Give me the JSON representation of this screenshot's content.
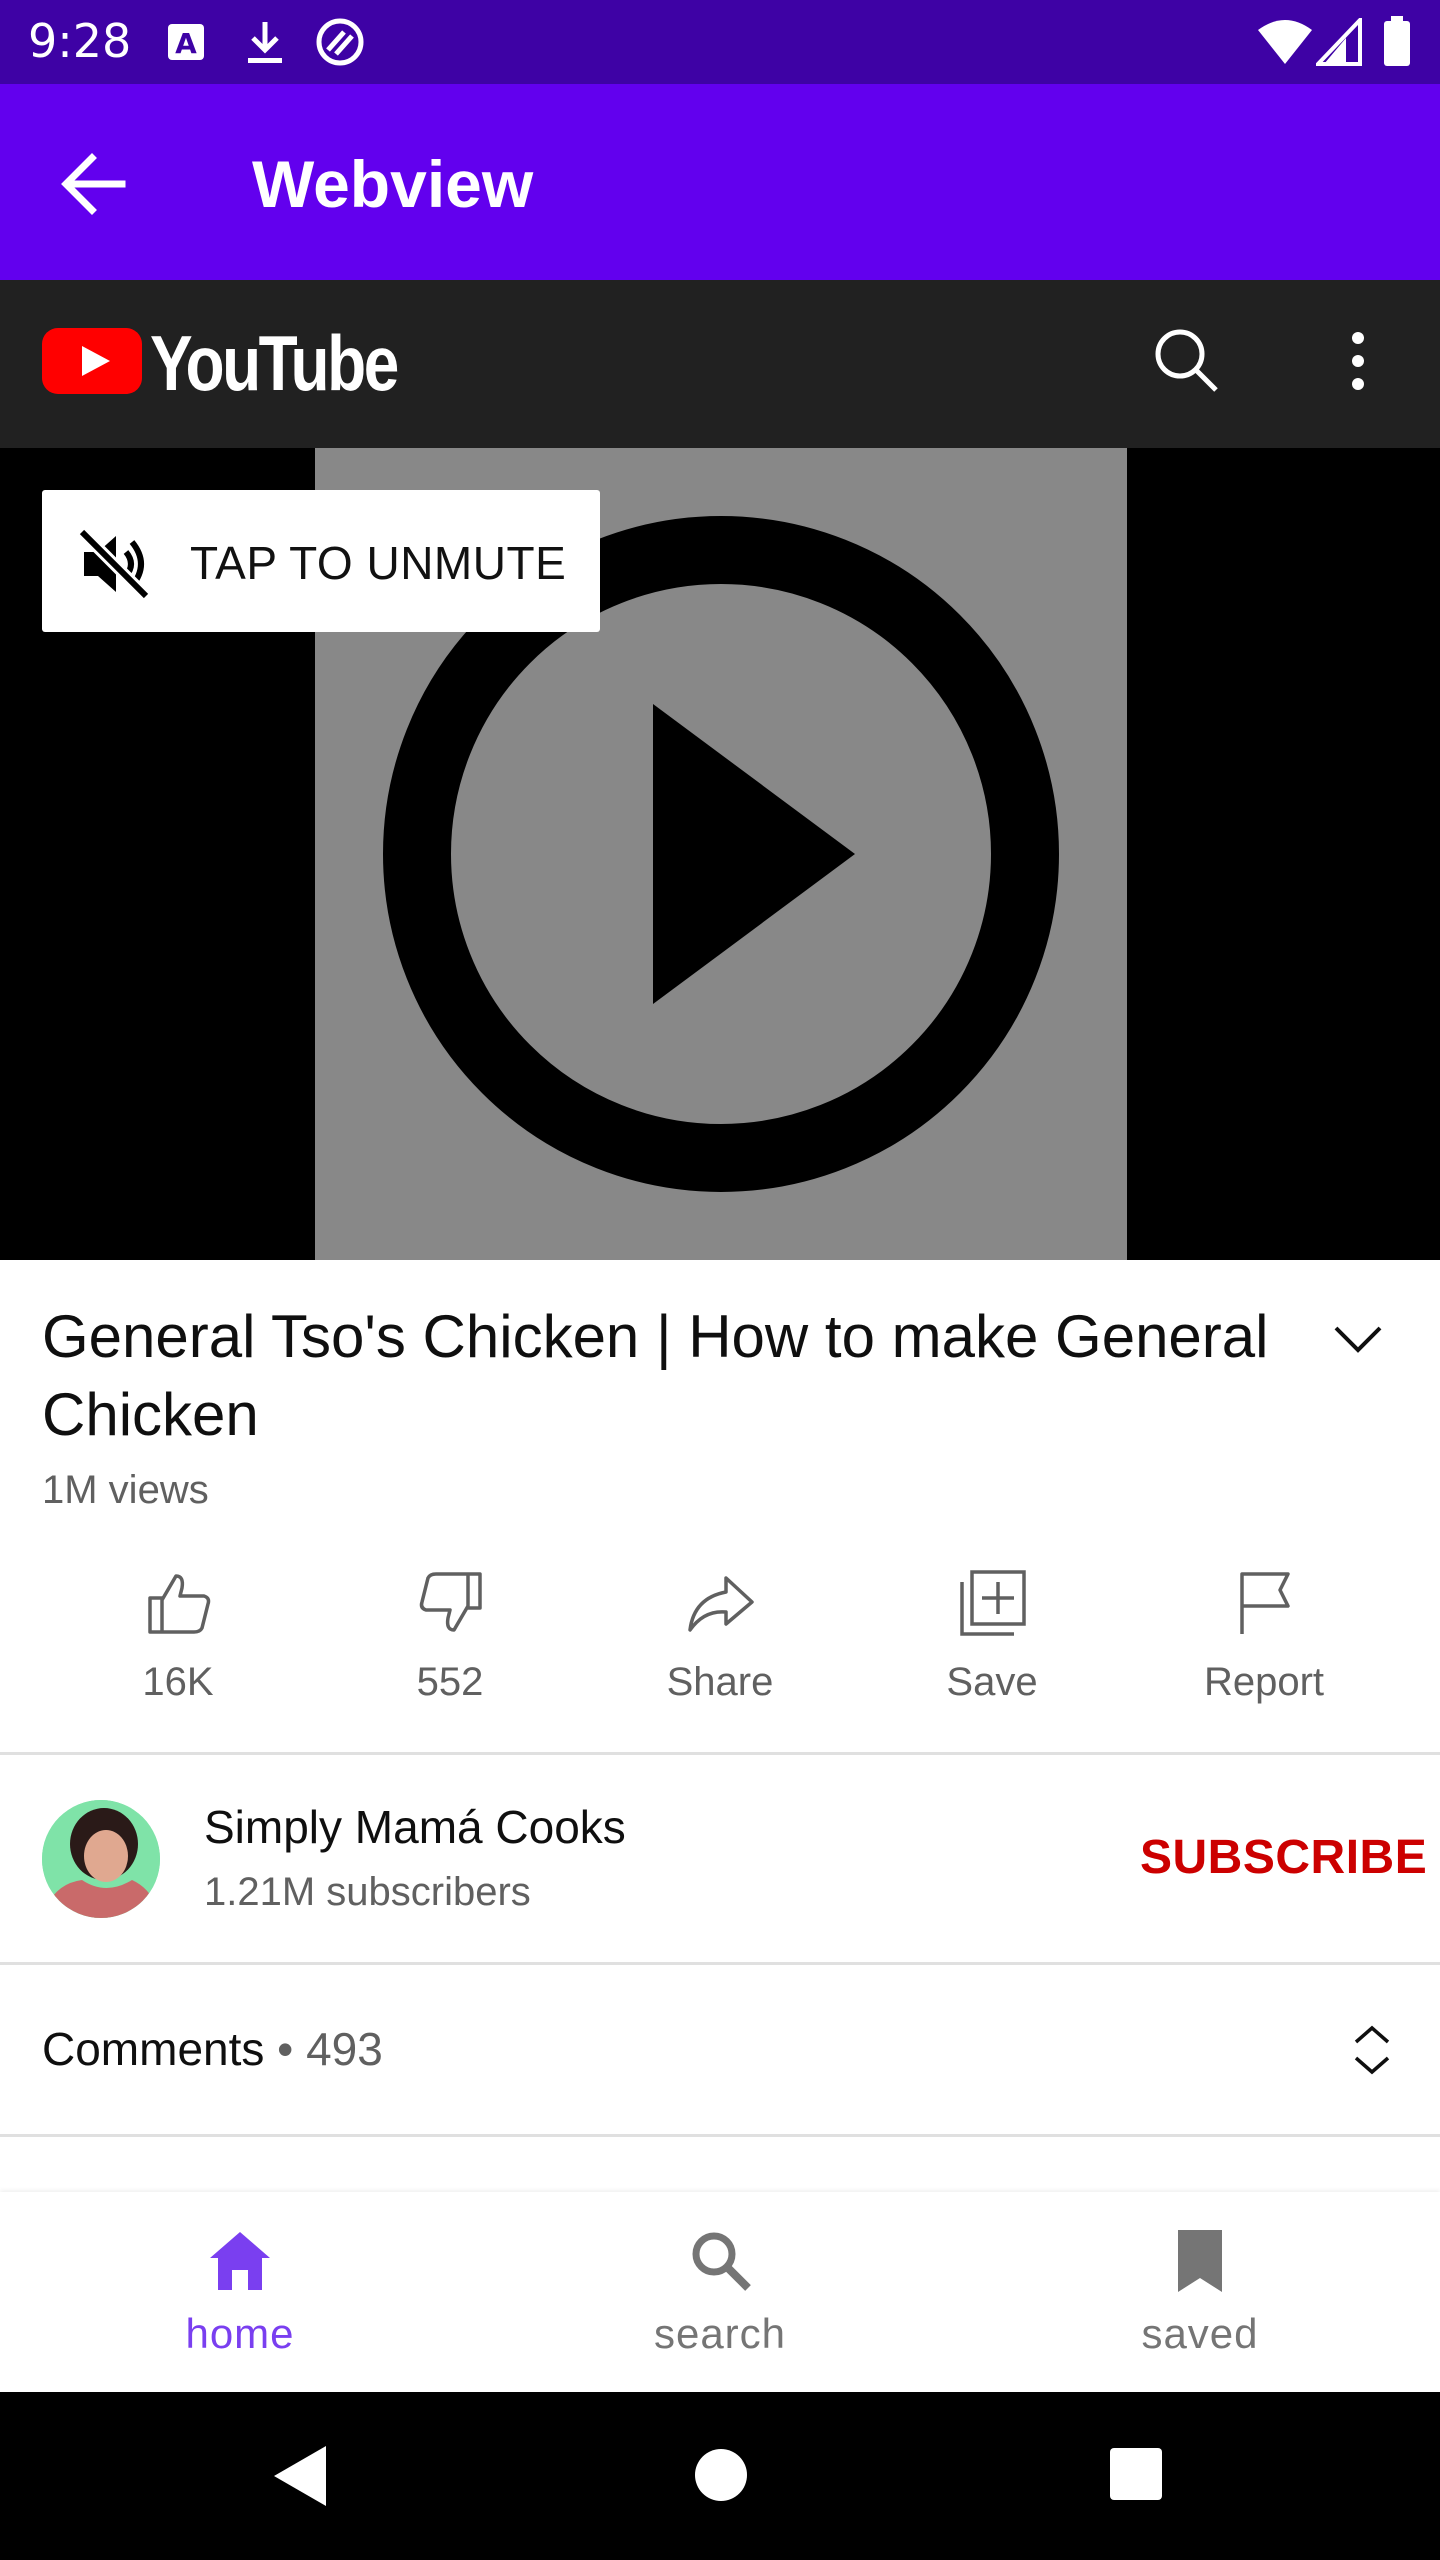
{
  "status_bar": {
    "time": "9:28",
    "left_icons": [
      "text-a-icon",
      "download-icon",
      "vpn-icon"
    ],
    "right_icons": [
      "wifi-icon",
      "cell-signal-icon",
      "battery-icon"
    ]
  },
  "app_bar": {
    "back_icon": "arrow-back-icon",
    "title": "Webview"
  },
  "youtube_header": {
    "logo_text": "YouTube",
    "icons": [
      "search-icon",
      "more-vert-icon"
    ]
  },
  "video": {
    "unmute_label": "TAP TO UNMUTE",
    "play_icon": "play-circle-icon"
  },
  "video_info": {
    "title": "General Tso's Chicken | How to make General Chicken",
    "views": "1M views"
  },
  "actions": [
    {
      "icon": "thumb-up-icon",
      "label": "16K"
    },
    {
      "icon": "thumb-down-icon",
      "label": "552"
    },
    {
      "icon": "share-icon",
      "label": "Share"
    },
    {
      "icon": "playlist-add-icon",
      "label": "Save"
    },
    {
      "icon": "flag-icon",
      "label": "Report"
    }
  ],
  "channel": {
    "name": "Simply Mamá Cooks",
    "subscribers": "1.21M subscribers",
    "subscribe_label": "SUBSCRIBE"
  },
  "comments": {
    "label": "Comments",
    "separator": " • ",
    "count": "493"
  },
  "bottom_nav": {
    "items": [
      {
        "icon": "home-icon",
        "label": "home",
        "active": true
      },
      {
        "icon": "search-icon",
        "label": "search",
        "active": false
      },
      {
        "icon": "bookmark-icon",
        "label": "saved",
        "active": false
      }
    ]
  },
  "colors": {
    "status_bar": "#3e02a5",
    "app_bar": "#6200ee",
    "youtube_header": "#212121",
    "youtube_red": "#ff0000",
    "subscribe": "#cc0000",
    "nav_active": "#7a3ff0",
    "nav_inactive": "#757575"
  }
}
